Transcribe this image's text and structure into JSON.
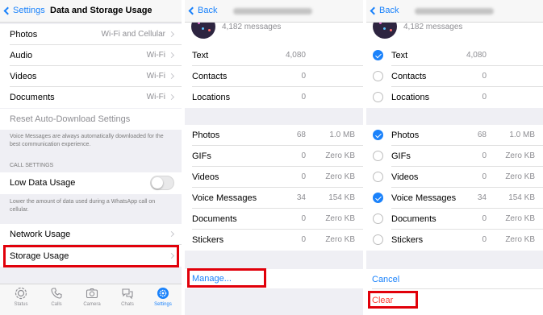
{
  "colors": {
    "accent": "#1a82fb",
    "destructive": "#ff3b30",
    "highlight": "#e1000a"
  },
  "panel1": {
    "back_label": "Settings",
    "title": "Data and Storage Usage",
    "auto_download": [
      {
        "label": "Photos",
        "value": "Wi-Fi and Cellular"
      },
      {
        "label": "Audio",
        "value": "Wi-Fi"
      },
      {
        "label": "Videos",
        "value": "Wi-Fi"
      },
      {
        "label": "Documents",
        "value": "Wi-Fi"
      }
    ],
    "reset_label": "Reset Auto-Download Settings",
    "voice_note": "Voice Messages are always automatically downloaded for the best communication experience.",
    "call_section": "CALL SETTINGS",
    "low_data_label": "Low Data Usage",
    "low_data_enabled": false,
    "low_data_note": "Lower the amount of data used during a WhatsApp call on cellular.",
    "network_usage_label": "Network Usage",
    "storage_usage_label": "Storage Usage",
    "tabs": [
      {
        "label": "Status",
        "icon": "status-icon"
      },
      {
        "label": "Calls",
        "icon": "phone-icon"
      },
      {
        "label": "Camera",
        "icon": "camera-icon"
      },
      {
        "label": "Chats",
        "icon": "chat-bubbles-icon"
      },
      {
        "label": "Settings",
        "icon": "gear-icon",
        "active": true
      }
    ]
  },
  "panel2": {
    "back_label": "Back",
    "message_count": "4,182 messages",
    "group1": [
      {
        "label": "Text",
        "count": "4,080"
      },
      {
        "label": "Contacts",
        "count": "0"
      },
      {
        "label": "Locations",
        "count": "0"
      }
    ],
    "group2": [
      {
        "label": "Photos",
        "count": "68",
        "size": "1.0 MB"
      },
      {
        "label": "GIFs",
        "count": "0",
        "size": "Zero KB"
      },
      {
        "label": "Videos",
        "count": "0",
        "size": "Zero KB"
      },
      {
        "label": "Voice Messages",
        "count": "34",
        "size": "154 KB"
      },
      {
        "label": "Documents",
        "count": "0",
        "size": "Zero KB"
      },
      {
        "label": "Stickers",
        "count": "0",
        "size": "Zero KB"
      }
    ],
    "manage_label": "Manage..."
  },
  "panel3": {
    "back_label": "Back",
    "message_count": "4,182 messages",
    "group1": [
      {
        "label": "Text",
        "count": "4,080",
        "checked": true
      },
      {
        "label": "Contacts",
        "count": "0",
        "checked": false
      },
      {
        "label": "Locations",
        "count": "0",
        "checked": false
      }
    ],
    "group2": [
      {
        "label": "Photos",
        "count": "68",
        "size": "1.0 MB",
        "checked": true
      },
      {
        "label": "GIFs",
        "count": "0",
        "size": "Zero KB",
        "checked": false
      },
      {
        "label": "Videos",
        "count": "0",
        "size": "Zero KB",
        "checked": false
      },
      {
        "label": "Voice Messages",
        "count": "34",
        "size": "154 KB",
        "checked": true
      },
      {
        "label": "Documents",
        "count": "0",
        "size": "Zero KB",
        "checked": false
      },
      {
        "label": "Stickers",
        "count": "0",
        "size": "Zero KB",
        "checked": false
      }
    ],
    "cancel_label": "Cancel",
    "clear_label": "Clear"
  }
}
